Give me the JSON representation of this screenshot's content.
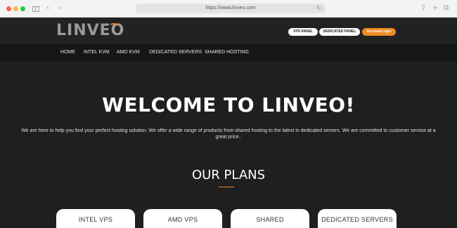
{
  "browser": {
    "url": "https://www.linveo.com"
  },
  "header": {
    "logo_text": "LINVEO",
    "buttons": {
      "vps_panel": "VPS PANEL",
      "dedicated_panel": "DEDICATED PANEL",
      "account_login": "Account Login"
    }
  },
  "nav": {
    "items": [
      "HOME",
      "INTEL KVM",
      "AMD KVM",
      "DEDICATED SERVERS",
      "SHARED HOSTING"
    ]
  },
  "hero": {
    "title": "WELCOME TO LINVEO!",
    "subtitle_line1": "We are here to help you find your perfect hosting solution. We offer a wide range of products from shared hosting to the latest in dedicated servers. We are committed to customer service at a",
    "subtitle_line2": "great price.."
  },
  "plans": {
    "title": "OUR PLANS",
    "cards": [
      "INTEL VPS",
      "AMD VPS",
      "SHARED",
      "DEDICATED SERVERS"
    ]
  },
  "colors": {
    "accent": "#f08a24",
    "background": "#1f1f1f"
  }
}
